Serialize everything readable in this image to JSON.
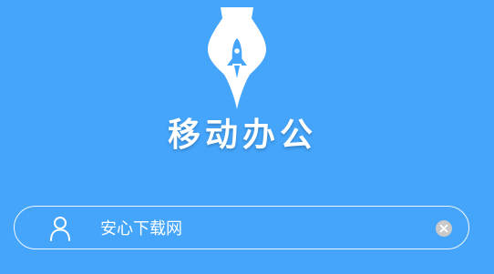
{
  "app": {
    "title": "移动办公",
    "logo_icon": "pen-nib-rocket-icon"
  },
  "login": {
    "username": {
      "value": "安心下载网",
      "placeholder": "",
      "leading_icon": "user-icon",
      "clear_icon": "clear-icon"
    }
  },
  "colors": {
    "background": "#44a5fb",
    "foreground": "#ffffff",
    "clear_button": "#c9c9c9"
  }
}
